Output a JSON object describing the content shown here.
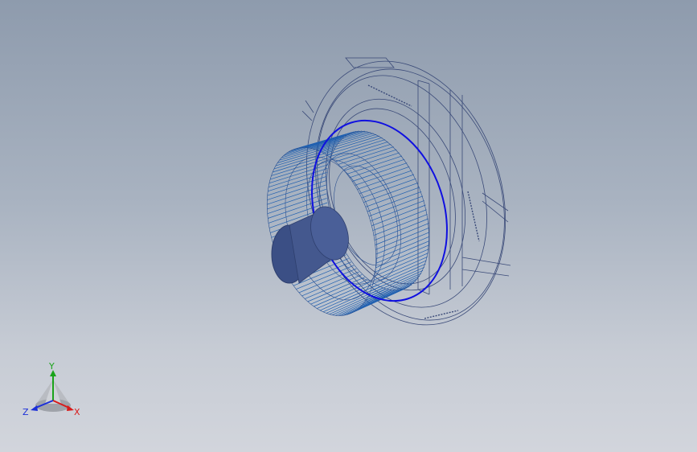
{
  "viewport": {
    "background_top": "#8e9bad",
    "background_bottom": "#d2d5dc"
  },
  "model": {
    "wireframe_color": "#1e5fb0",
    "highlight_color": "#1010e0",
    "edge_color": "#3a4a78"
  },
  "triad": {
    "x_label": "X",
    "y_label": "Y",
    "z_label": "Z",
    "x_color": "#d81b1b",
    "y_color": "#1aa31a",
    "z_color": "#1b2fd8"
  }
}
